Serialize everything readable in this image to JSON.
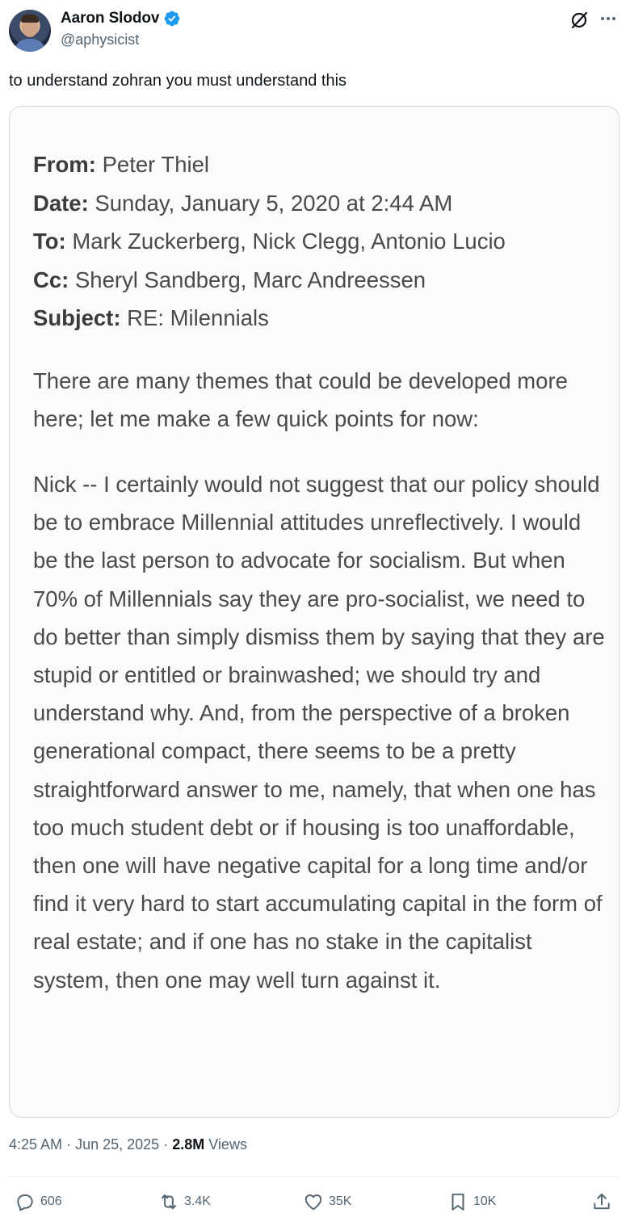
{
  "author": {
    "display_name": "Aaron Slodov",
    "handle": "@aphysicist",
    "verified": true,
    "accent_color": "#1d9bf0"
  },
  "toolbar": {
    "grok_icon": "grok-icon",
    "more_icon": "more-icon"
  },
  "tweet": {
    "text": "to understand zohran you must understand this"
  },
  "email": {
    "from_label": "From:",
    "from_value": "Peter Thiel",
    "date_label": "Date:",
    "date_value": "Sunday, January 5, 2020 at 2:44 AM",
    "to_label": "To:",
    "to_value": "Mark Zuckerberg, Nick Clegg, Antonio Lucio",
    "cc_label": "Cc:",
    "cc_value": "Sheryl Sandberg, Marc Andreessen",
    "subject_label": "Subject:",
    "subject_value": "RE: Milennials",
    "paragraph1": "There are many themes that could be developed more here; let me make a few quick points for now:",
    "paragraph2": "Nick -- I certainly would not suggest that our policy should be to embrace Millennial attitudes unreflectively. I would be the last person to advocate for socialism. But when 70% of Millennials say they are pro-socialist, we need to do better than simply dismiss them by saying that they are stupid or entitled or brainwashed; we should try and understand why. And, from the perspective of a broken generational compact, there seems to be a pretty straightforward answer to me, namely, that when one has too much student debt or if housing is too unaffordable, then one will have negative capital for a long time and/or find it very hard to start accumulating capital in the form of real estate; and if one has no stake in the capitalist system, then one may well turn against it."
  },
  "meta": {
    "time": "4:25 AM",
    "separator": "·",
    "date": "Jun 25, 2025",
    "views_count": "2.8M",
    "views_label": "Views"
  },
  "actions": {
    "replies": "606",
    "reposts": "3.4K",
    "likes": "35K",
    "bookmarks": "10K"
  }
}
